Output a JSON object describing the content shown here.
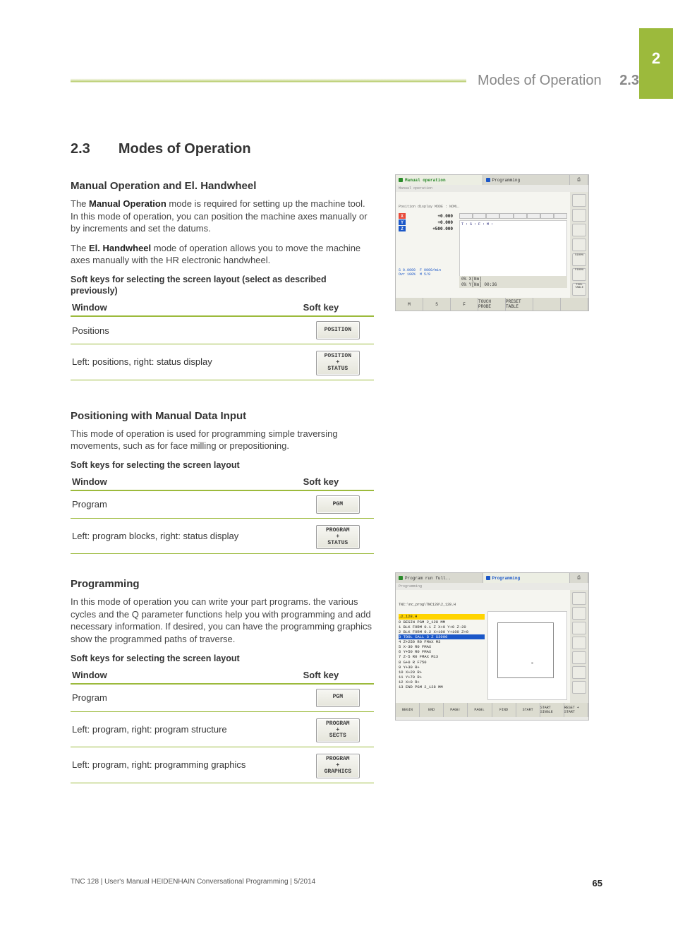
{
  "chapter": "2",
  "header": {
    "title": "Modes of Operation",
    "num": "2.3"
  },
  "section_title_num": "2.3",
  "section_title": "Modes of Operation",
  "page_number": "65",
  "footer_text": "TNC 128 | User's Manual HEIDENHAIN Conversational Programming | 5/2014",
  "s1": {
    "title": "Manual Operation and El. Handwheel",
    "p1a": "The ",
    "p1b": "Manual Operation",
    "p1c": " mode is required for setting up the machine tool. In this mode of operation, you can position the machine axes manually or by increments and set the datums.",
    "p2a": "The ",
    "p2b": "El. Handwheel",
    "p2c": " mode of operation allows you to move the machine axes manually with the HR electronic handwheel.",
    "caption": "Soft keys for selecting the screen layout (select as described previously)",
    "th1": "Window",
    "th2": "Soft key",
    "r1": "Positions",
    "k1": "POSITION",
    "r2": "Left: positions, right: status display",
    "k2a": "POSITION",
    "k2b": "+",
    "k2c": "STATUS"
  },
  "s2": {
    "title": "Positioning with Manual Data Input",
    "p1": "This mode of operation is used for programming simple traversing movements, such as for face milling or prepositioning.",
    "caption": "Soft keys for selecting the screen layout",
    "th1": "Window",
    "th2": "Soft key",
    "r1": "Program",
    "k1": "PGM",
    "r2": "Left: program blocks, right: status display",
    "k2a": "PROGRAM",
    "k2b": "+",
    "k2c": "STATUS"
  },
  "s3": {
    "title": "Programming",
    "p1": "In this mode of operation you can write your part programs. the various cycles and the Q parameter functions help you with programming and add necessary information. If desired, you can have the programming graphics show the programmed paths of traverse.",
    "caption": "Soft keys for selecting the screen layout",
    "th1": "Window",
    "th2": "Soft key",
    "r1": "Program",
    "k1": "PGM",
    "r2": "Left: program, right: program structure",
    "k2a": "PROGRAM",
    "k2b": "+",
    "k2c": "SECTS",
    "r3": "Left: program, right: programming graphics",
    "k3a": "PROGRAM",
    "k3b": "+",
    "k3c": "GRAPHICS"
  },
  "ss1": {
    "tab1": "Manual operation",
    "tab1sub": "Manual operation",
    "tab2": "Programming",
    "pos_header": "Position display MODE : NOML.",
    "axes": [
      {
        "ax": "X",
        "col": "#e84a3a",
        "val": "+0.000"
      },
      {
        "ax": "Y",
        "col": "#1b57c8",
        "val": "+0.000"
      },
      {
        "ax": "Z",
        "col": "#1b57c8",
        "val": "+500.000"
      }
    ],
    "status_rows": "T : S :\nF : M :",
    "bottom_left": "S 0.0000  F 0000/min\nOvr 100%  M 5/9",
    "timebar1": "0% X[Nm]",
    "timebar2": "0% Y[Nm] 00:36",
    "foot": [
      "M",
      "S",
      "F",
      "TOUCH PROBE",
      "PRESET TABLE",
      "",
      ""
    ],
    "side_right": [
      "",
      "",
      "",
      "",
      "S100%",
      "F100%",
      "TOOL TABLE"
    ]
  },
  "ss2": {
    "tab1": "Program run full..",
    "tab2": "Programming",
    "tab2sub": "Programming",
    "file": "TNC:\\nc_prog\\TNC128\\2_128.H",
    "hilite": "→2_128.H",
    "lines": [
      "0  BEGIN PGM 2_128 MM",
      "1  BLK FORM 0.1 Z X+0 Y+0 Z-20",
      "2  BLK FORM 0.2  X+100  Y+100  Z+0",
      "3  TOOL CALL 3 Z S3000",
      "4   Z+250 R0 FMAX M3",
      "5   X-30 R0 FMAX",
      "6   Y+50 R0 FMAX",
      "7   Z-5 R0 FMAX M13",
      "8   G+0 R  F750",
      "9   Y+30 R+",
      "10  X+20 R+",
      "11  Y+70 R+",
      "12  X+0 R+",
      "13 END PGM 2_128 MM"
    ],
    "foot": [
      "BEGIN",
      "END",
      "PAGE↑",
      "PAGE↓",
      "FIND",
      "START",
      "START SINGLE",
      "RESET + START"
    ]
  }
}
